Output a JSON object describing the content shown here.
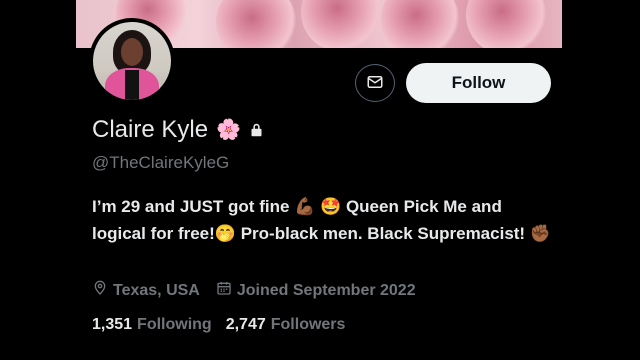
{
  "profile": {
    "display_name": "Claire Kyle",
    "name_emoji": "🌸",
    "handle": "@TheClaireKyleG",
    "bio": {
      "part1": "I’m 29 and JUST got fine ",
      "emoji1": "💪🏾",
      "emoji2": "🤩",
      "part2": " Queen Pick Me and logical for free!",
      "emoji3": "🤭",
      "part3": " Pro-black men. Black Supremacist! ",
      "emoji4": "✊🏾"
    },
    "location": "Texas, USA",
    "joined": "Joined September 2022",
    "following_count": "1,351",
    "following_label": "Following",
    "followers_count": "2,747",
    "followers_label": "Followers"
  },
  "actions": {
    "follow_label": "Follow"
  },
  "icons": {
    "message": "envelope-icon",
    "lock": "lock-icon",
    "location": "location-pin-icon",
    "calendar": "calendar-icon"
  },
  "colors": {
    "background": "#000000",
    "primary_text": "#e7e9ea",
    "secondary_text": "#71767b",
    "follow_button_bg": "#eff3f4",
    "follow_button_text": "#0f1419"
  }
}
